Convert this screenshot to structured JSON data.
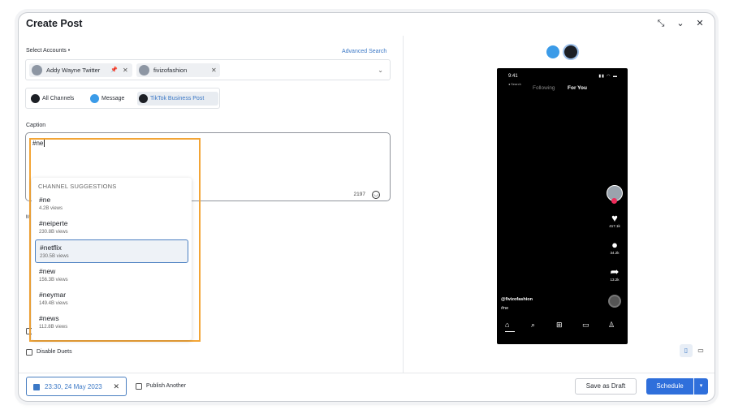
{
  "window": {
    "title": "Create Post",
    "controls": {
      "minimize_icon": "collapse-arrows-icon",
      "chevron_icon": "chevron-down-icon",
      "close_icon": "close-icon"
    }
  },
  "accounts": {
    "label": "Select Accounts",
    "required_mark": "•",
    "advanced_search": "Advanced Search",
    "chips": [
      {
        "name": "Addy Wayne Twitter"
      },
      {
        "name": "fivizofashion"
      }
    ]
  },
  "channels": {
    "tabs": [
      {
        "label": "All Channels",
        "icon": "globe-icon"
      },
      {
        "label": "Message",
        "icon": "twitter-icon"
      },
      {
        "label": "TikTok Business Post",
        "icon": "tiktok-icon",
        "active": true
      }
    ]
  },
  "caption": {
    "label": "Caption",
    "value": "#ne",
    "char_count": "2197"
  },
  "suggestions": {
    "header": "CHANNEL SUGGESTIONS",
    "items": [
      {
        "tag": "#ne",
        "views": "4.2B views"
      },
      {
        "tag": "#neiperte",
        "views": "230.8B views"
      },
      {
        "tag": "#netflix",
        "views": "230.5B views",
        "selected": true
      },
      {
        "tag": "#new",
        "views": "156.3B views"
      },
      {
        "tag": "#neymar",
        "views": "149.4B views"
      },
      {
        "tag": "#news",
        "views": "112.8B views"
      }
    ]
  },
  "options": {
    "disable_duets": "Disable Duets",
    "publish_another": "Publish Another"
  },
  "footer": {
    "date": "23:30, 24 May 2023",
    "save_draft": "Save as Draft",
    "schedule": "Schedule"
  },
  "preview": {
    "time": "9:41",
    "search_label": "◂ Search",
    "following": "Following",
    "for_you": "For You",
    "likes": "417.1k",
    "comments": "34.2k",
    "shares": "13.2k",
    "username": "@fivizofashion",
    "caption": "#ne"
  },
  "colors": {
    "accent": "#3b78c6",
    "highlight_frame": "#f3a536",
    "schedule": "#2f6fdb"
  }
}
